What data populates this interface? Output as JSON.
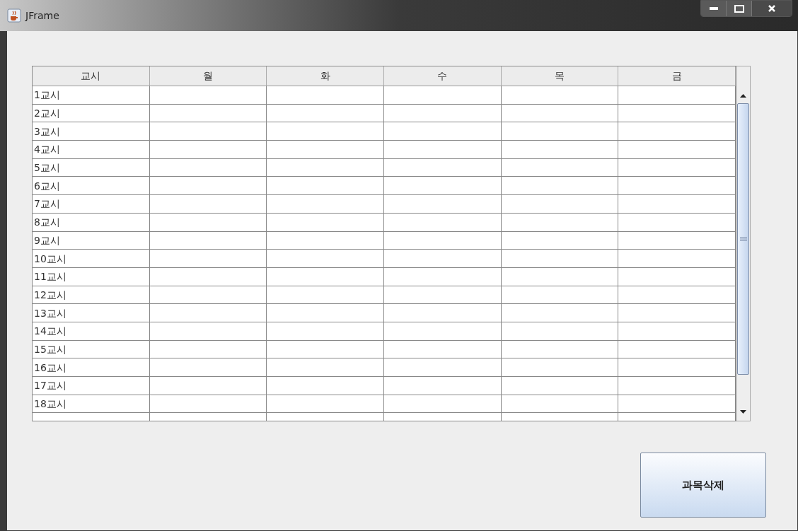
{
  "window": {
    "title": "JFrame"
  },
  "table": {
    "columns": [
      "교시",
      "월",
      "화",
      "수",
      "목",
      "금"
    ],
    "rows": [
      [
        "1교시",
        "",
        "",
        "",
        "",
        ""
      ],
      [
        "2교시",
        "",
        "",
        "",
        "",
        ""
      ],
      [
        "3교시",
        "",
        "",
        "",
        "",
        ""
      ],
      [
        "4교시",
        "",
        "",
        "",
        "",
        ""
      ],
      [
        "5교시",
        "",
        "",
        "",
        "",
        ""
      ],
      [
        "6교시",
        "",
        "",
        "",
        "",
        ""
      ],
      [
        "7교시",
        "",
        "",
        "",
        "",
        ""
      ],
      [
        "8교시",
        "",
        "",
        "",
        "",
        ""
      ],
      [
        "9교시",
        "",
        "",
        "",
        "",
        ""
      ],
      [
        "10교시",
        "",
        "",
        "",
        "",
        ""
      ],
      [
        "11교시",
        "",
        "",
        "",
        "",
        ""
      ],
      [
        "12교시",
        "",
        "",
        "",
        "",
        ""
      ],
      [
        "13교시",
        "",
        "",
        "",
        "",
        ""
      ],
      [
        "14교시",
        "",
        "",
        "",
        "",
        ""
      ],
      [
        "15교시",
        "",
        "",
        "",
        "",
        ""
      ],
      [
        "16교시",
        "",
        "",
        "",
        "",
        ""
      ],
      [
        "17교시",
        "",
        "",
        "",
        "",
        ""
      ],
      [
        "18교시",
        "",
        "",
        "",
        "",
        ""
      ]
    ]
  },
  "buttons": [
    "과목삭제"
  ]
}
